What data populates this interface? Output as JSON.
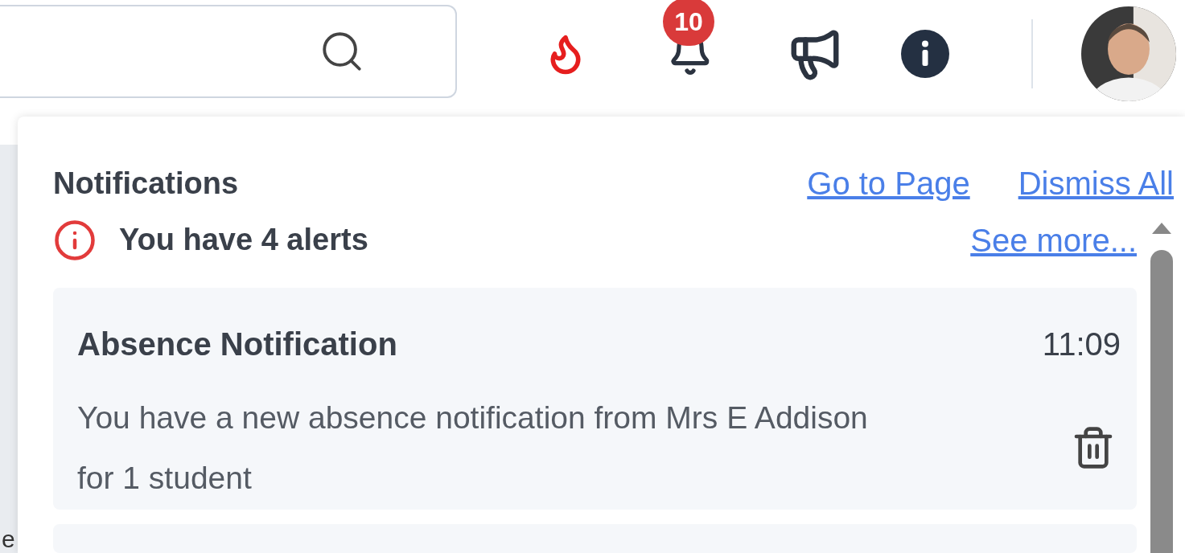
{
  "header": {
    "notification_count": "10"
  },
  "notifications": {
    "title": "Notifications",
    "actions": [
      "Go to Page",
      "Dismiss All"
    ],
    "alert_summary": "You have 4 alerts",
    "see_more": "See more...",
    "items": [
      {
        "title": "Absence Notification",
        "time": "11:09",
        "body": "You have a new absence notification from Mrs E Addison for 1 student"
      }
    ]
  },
  "sidebar_fragment": "e"
}
